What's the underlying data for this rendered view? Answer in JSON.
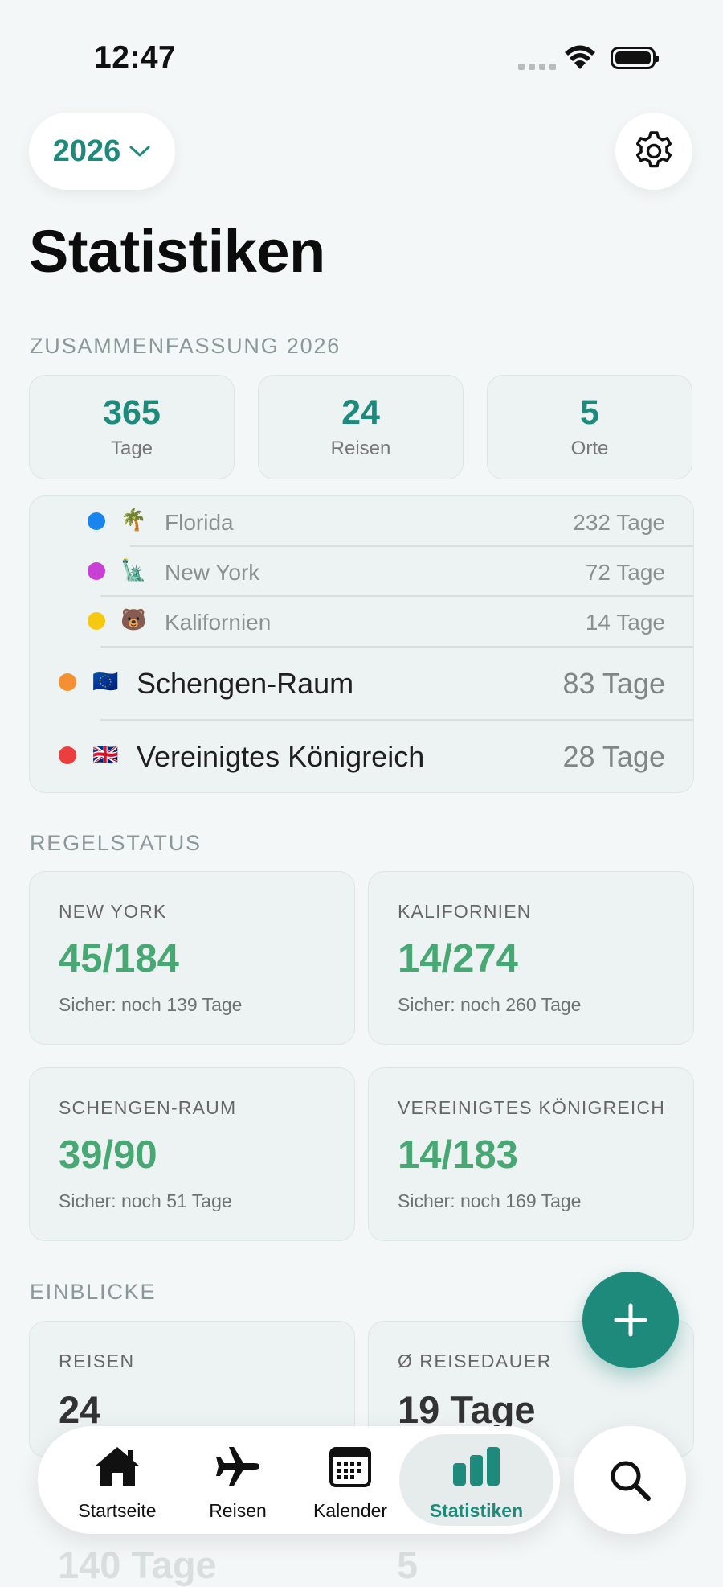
{
  "status_bar": {
    "time": "12:47"
  },
  "header": {
    "year": "2026",
    "title": "Statistiken"
  },
  "summary": {
    "label": "ZUSAMMENFASSUNG 2026",
    "stats": [
      {
        "value": "365",
        "label": "Tage"
      },
      {
        "value": "24",
        "label": "Reisen"
      },
      {
        "value": "5",
        "label": "Orte"
      }
    ],
    "subregions": [
      {
        "emoji": "🌴",
        "name": "Florida",
        "days": "232 Tage",
        "color": "#1a85ef"
      },
      {
        "emoji": "🗽",
        "name": "New York",
        "days": "72 Tage",
        "color": "#c940d4"
      },
      {
        "emoji": "🐻",
        "name": "Kalifornien",
        "days": "14 Tage",
        "color": "#f5c90f"
      }
    ],
    "regions": [
      {
        "emoji": "🇪🇺",
        "name": "Schengen-Raum",
        "days": "83 Tage",
        "color": "#f39132"
      },
      {
        "emoji": "🇬🇧",
        "name": "Vereinigtes Königreich",
        "days": "28 Tage",
        "color": "#ec3e3e"
      }
    ]
  },
  "rules": {
    "label": "REGELSTATUS",
    "items": [
      {
        "name": "NEW YORK",
        "value": "45/184",
        "sub": "Sicher: noch 139 Tage"
      },
      {
        "name": "KALIFORNIEN",
        "value": "14/274",
        "sub": "Sicher: noch 260 Tage"
      },
      {
        "name": "SCHENGEN-RAUM",
        "value": "39/90",
        "sub": "Sicher: noch 51 Tage"
      },
      {
        "name": "VEREINIGTES KÖNIGREICH",
        "value": "14/183",
        "sub": "Sicher: noch 169 Tage"
      }
    ]
  },
  "insights": {
    "label": "EINBLICKE",
    "items": [
      {
        "name": "REISEN",
        "value": "24"
      },
      {
        "name": "Ø REISEDAUER",
        "value": "19 Tage"
      }
    ],
    "partial": [
      "140 Tage",
      "5"
    ]
  },
  "tabs": [
    {
      "label": "Startseite",
      "icon": "house-icon"
    },
    {
      "label": "Reisen",
      "icon": "airplane-icon"
    },
    {
      "label": "Kalender",
      "icon": "calendar-icon"
    },
    {
      "label": "Statistiken",
      "icon": "chart-bars-icon",
      "active": true
    }
  ],
  "colors": {
    "accent": "#1d8a7c",
    "safe": "#47a873"
  }
}
